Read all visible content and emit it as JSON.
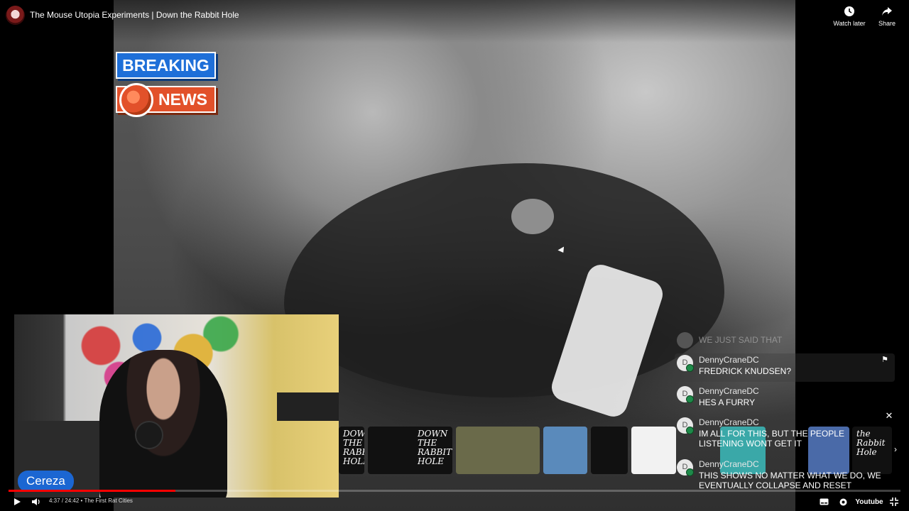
{
  "player": {
    "video_title": "The Mouse Utopia Experiments | Down the Rabbit Hole",
    "watch_later_label": "Watch later",
    "share_label": "Share",
    "time_current": "4:37",
    "time_total": "24:42",
    "time_separator": "/",
    "chapter_bullet": "•",
    "chapter": "The First Rat Cities",
    "progress_fraction": 0.187,
    "youtube_label": "Youtube"
  },
  "overlay": {
    "breaking": "BREAKING",
    "news": "NEWS"
  },
  "webcam": {
    "streamer_name": "Cereza"
  },
  "endscreen": {
    "thumb_text_a": "DOWN THE RABBIT HOLE",
    "thumb_text_b": "DOWN THE RABBIT HOLE",
    "thumb_text_c": "the Rabbit Hole"
  },
  "chat": {
    "faded_message": "WE JUST SAID THAT",
    "messages": [
      {
        "avatar_letter": "D",
        "user": "DennyCraneDC",
        "text": "FREDRICK KNUDSEN?"
      },
      {
        "avatar_letter": "D",
        "user": "DennyCraneDC",
        "text": "HES A FURRY"
      },
      {
        "avatar_letter": "D",
        "user": "DennyCraneDC",
        "text": "IM ALL FOR THIS, BUT THE PEOPLE LISTENING WONT GET IT"
      },
      {
        "avatar_letter": "D",
        "user": "DennyCraneDC",
        "text": "THIS SHOWS NO MATTER WHAT WE DO, WE EVENTUALLY COLLAPSE AND RESET"
      }
    ]
  },
  "colors": {
    "breaking_bg": "#1e6fd8",
    "news_bg": "#e2512a",
    "nameplate_bg": "#1b66d2",
    "progress_fill": "#ff0000"
  }
}
